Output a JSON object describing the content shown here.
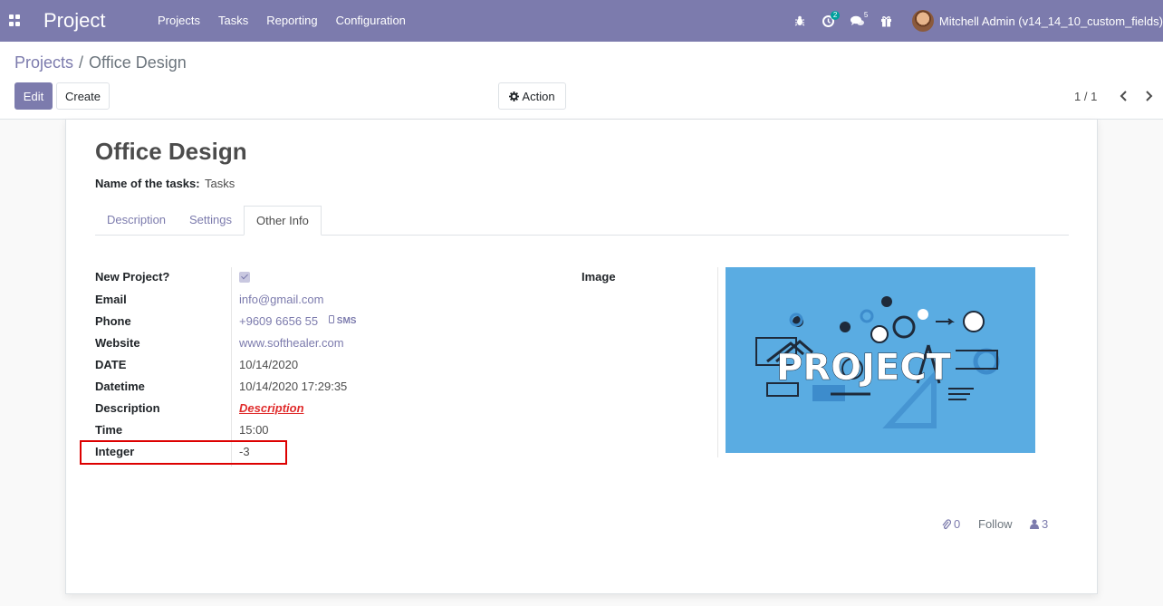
{
  "navbar": {
    "app_name": "Project",
    "menu": [
      "Projects",
      "Tasks",
      "Reporting",
      "Configuration"
    ],
    "activity_badge": "2",
    "messages_badge": "5",
    "user_name": "Mitchell Admin (v14_14_10_custom_fields)"
  },
  "breadcrumb": {
    "parent": "Projects",
    "separator": "/",
    "current": "Office Design"
  },
  "buttons": {
    "edit": "Edit",
    "create": "Create",
    "action": "Action"
  },
  "pager": {
    "value": "1 / 1"
  },
  "record": {
    "title": "Office Design",
    "tasks_label": "Name of the tasks:",
    "tasks_value": "Tasks"
  },
  "tabs": {
    "description": "Description",
    "settings": "Settings",
    "other_info": "Other Info"
  },
  "fields": {
    "new_project": {
      "label": "New Project?",
      "value": true
    },
    "email": {
      "label": "Email",
      "value": "info@gmail.com"
    },
    "phone": {
      "label": "Phone",
      "value": "+9609 6656 55",
      "sms": "SMS"
    },
    "website": {
      "label": "Website",
      "value": "www.softhealer.com"
    },
    "date": {
      "label": "DATE",
      "value": "10/14/2020"
    },
    "datetime": {
      "label": "Datetime",
      "value": "10/14/2020 17:29:35"
    },
    "description": {
      "label": "Description",
      "value": "Description"
    },
    "time": {
      "label": "Time",
      "value": "15:00"
    },
    "integer": {
      "label": "Integer",
      "value": "-3"
    },
    "image": {
      "label": "Image",
      "image_text": "PROJECT"
    }
  },
  "chatter": {
    "attachments": "0",
    "follow": "Follow",
    "followers": "3"
  },
  "colors": {
    "brand": "#7c7bad",
    "highlight": "#dd0000",
    "image_bg": "#5aace2",
    "description_link": "#e02c2c"
  }
}
